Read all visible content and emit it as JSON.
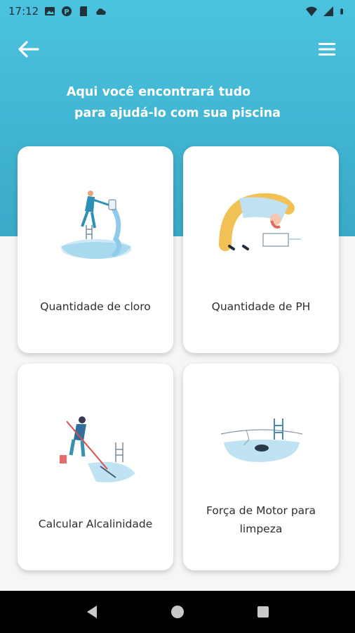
{
  "status_bar": {
    "time": "17:12",
    "left_icons": [
      "photo-icon",
      "circle-p-icon",
      "sd-card-icon",
      "cloud-icon"
    ],
    "right_icons": [
      "wifi-icon",
      "signal-icon",
      "battery-icon"
    ]
  },
  "header": {
    "title_line1": "Aqui você encontrará tudo",
    "title_line2": "para ajudá-lo com sua piscina",
    "back_icon": "arrow-left-icon",
    "menu_icon": "hamburger-menu-icon"
  },
  "cards": [
    {
      "label": "Quantidade de cloro",
      "icon": "pool-chlorine-illustration"
    },
    {
      "label": "Quantidade de PH",
      "icon": "ph-test-illustration"
    },
    {
      "label": "Calcular Alcalinidade",
      "icon": "pool-cleaning-illustration"
    },
    {
      "label_line1": "Força de Motor para",
      "label_line2": "limpeza",
      "icon": "pool-motor-illustration"
    }
  ],
  "nav_bar": {
    "buttons": [
      "back-triangle-icon",
      "home-circle-icon",
      "recents-square-icon"
    ]
  },
  "colors": {
    "header_top": "#4bc3df",
    "header_bottom": "#39a9c8",
    "background": "#f6f6f6",
    "card": "#ffffff",
    "label_text": "#2e2e2e"
  }
}
